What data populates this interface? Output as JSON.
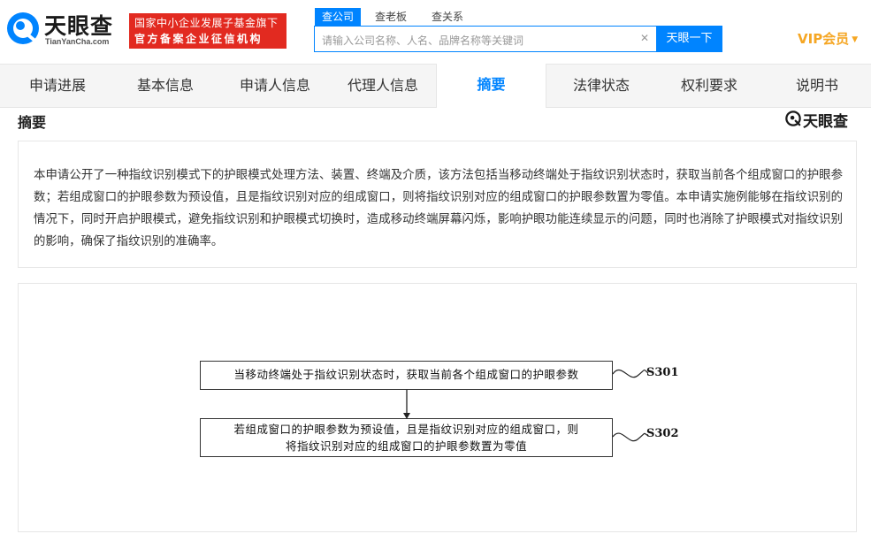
{
  "header": {
    "logo_text": "天眼查",
    "logo_sub": "TianYanCha.com",
    "badge_line1": "国家中小企业发展子基金旗下",
    "badge_line2": "官方备案企业征信机构",
    "search_tabs": [
      {
        "label": "查公司",
        "active": true
      },
      {
        "label": "查老板",
        "active": false
      },
      {
        "label": "查关系",
        "active": false
      }
    ],
    "search_placeholder": "请输入公司名称、人名、品牌名称等关键词",
    "search_button": "天眼一下",
    "vip_label": "VIP会员"
  },
  "nav": {
    "items": [
      {
        "label": "申请进展",
        "active": false
      },
      {
        "label": "基本信息",
        "active": false
      },
      {
        "label": "申请人信息",
        "active": false
      },
      {
        "label": "代理人信息",
        "active": false
      },
      {
        "label": "摘要",
        "active": true
      },
      {
        "label": "法律状态",
        "active": false
      },
      {
        "label": "权利要求",
        "active": false
      },
      {
        "label": "说明书",
        "active": false
      }
    ]
  },
  "abstract": {
    "title": "摘要",
    "brand": "天眼查",
    "text": "本申请公开了一种指纹识别模式下的护眼模式处理方法、装置、终端及介质，该方法包括当移动终端处于指纹识别状态时，获取当前各个组成窗口的护眼参数；若组成窗口的护眼参数为预设值，且是指纹识别对应的组成窗口，则将指纹识别对应的组成窗口的护眼参数置为零值。本申请实施例能够在指纹识别的情况下，同时开启护眼模式，避免指纹识别和护眼模式切换时，造成移动终端屏幕闪烁，影响护眼功能连续显示的问题，同时也消除了护眼模式对指纹识别的影响，确保了指纹识别的准确率。"
  },
  "figure": {
    "steps": [
      {
        "id": "S301",
        "text_line1": "当移动终端处于指纹识别状态时，获取当前各个组成窗口的护眼参数",
        "text_line2": ""
      },
      {
        "id": "S302",
        "text_line1": "若组成窗口的护眼参数为预设值，且是指纹识别对应的组成窗口，则",
        "text_line2": "将指纹识别对应的组成窗口的护眼参数置为零值"
      }
    ]
  },
  "colors": {
    "accent": "#0084ff",
    "badge": "#e22a20",
    "vip": "#f5a623"
  }
}
